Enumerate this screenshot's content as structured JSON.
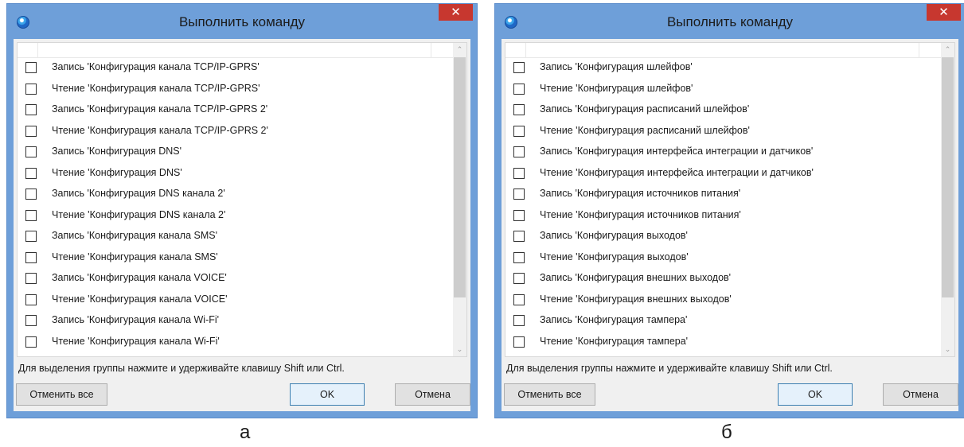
{
  "dialogs": [
    {
      "title": "Выполнить команду",
      "close": "✕",
      "items": [
        "Запись 'Конфигурация канала TCP/IP-GPRS'",
        "Чтение 'Конфигурация канала TCP/IP-GPRS'",
        "Запись 'Конфигурация канала TCP/IP-GPRS 2'",
        "Чтение 'Конфигурация канала TCP/IP-GPRS 2'",
        "Запись 'Конфигурация DNS'",
        "Чтение 'Конфигурация DNS'",
        "Запись 'Конфигурация DNS канала 2'",
        "Чтение 'Конфигурация DNS канала 2'",
        "Запись 'Конфигурация канала SMS'",
        "Чтение 'Конфигурация канала SMS'",
        "Запись 'Конфигурация канала VOICE'",
        "Чтение 'Конфигурация канала VOICE'",
        "Запись 'Конфигурация канала Wi-Fi'",
        "Чтение 'Конфигурация канала Wi-Fi'"
      ],
      "hint": "Для выделения группы нажмите и удерживайте клавишу Shift или Ctrl.",
      "deselect_label": "Отменить все",
      "ok_label": "OK",
      "cancel_label": "Отмена",
      "caption": "а"
    },
    {
      "title": "Выполнить команду",
      "close": "✕",
      "items": [
        "Запись 'Конфигурация шлейфов'",
        "Чтение 'Конфигурация шлейфов'",
        "Запись 'Конфигурация расписаний шлейфов'",
        "Чтение 'Конфигурация расписаний шлейфов'",
        "Запись 'Конфигурация интерфейса интеграции и датчиков'",
        "Чтение 'Конфигурация интерфейса интеграции и датчиков'",
        "Запись 'Конфигурация источников питания'",
        "Чтение 'Конфигурация источников питания'",
        "Запись 'Конфигурация выходов'",
        "Чтение 'Конфигурация выходов'",
        "Запись 'Конфигурация внешних выходов'",
        "Чтение 'Конфигурация внешних выходов'",
        "Запись 'Конфигурация тампера'",
        "Чтение 'Конфигурация тампера'"
      ],
      "hint": "Для выделения группы нажмите и удерживайте клавишу Shift или Ctrl.",
      "deselect_label": "Отменить все",
      "ok_label": "OK",
      "cancel_label": "Отмена",
      "caption": "б"
    }
  ],
  "scroll_up": "⌃",
  "scroll_down": "⌄",
  "colors": {
    "frame": "#6e9fd9",
    "close": "#c7372f",
    "body": "#f0f0f0"
  },
  "icons": {
    "app": "app-icon",
    "close": "close-icon"
  }
}
